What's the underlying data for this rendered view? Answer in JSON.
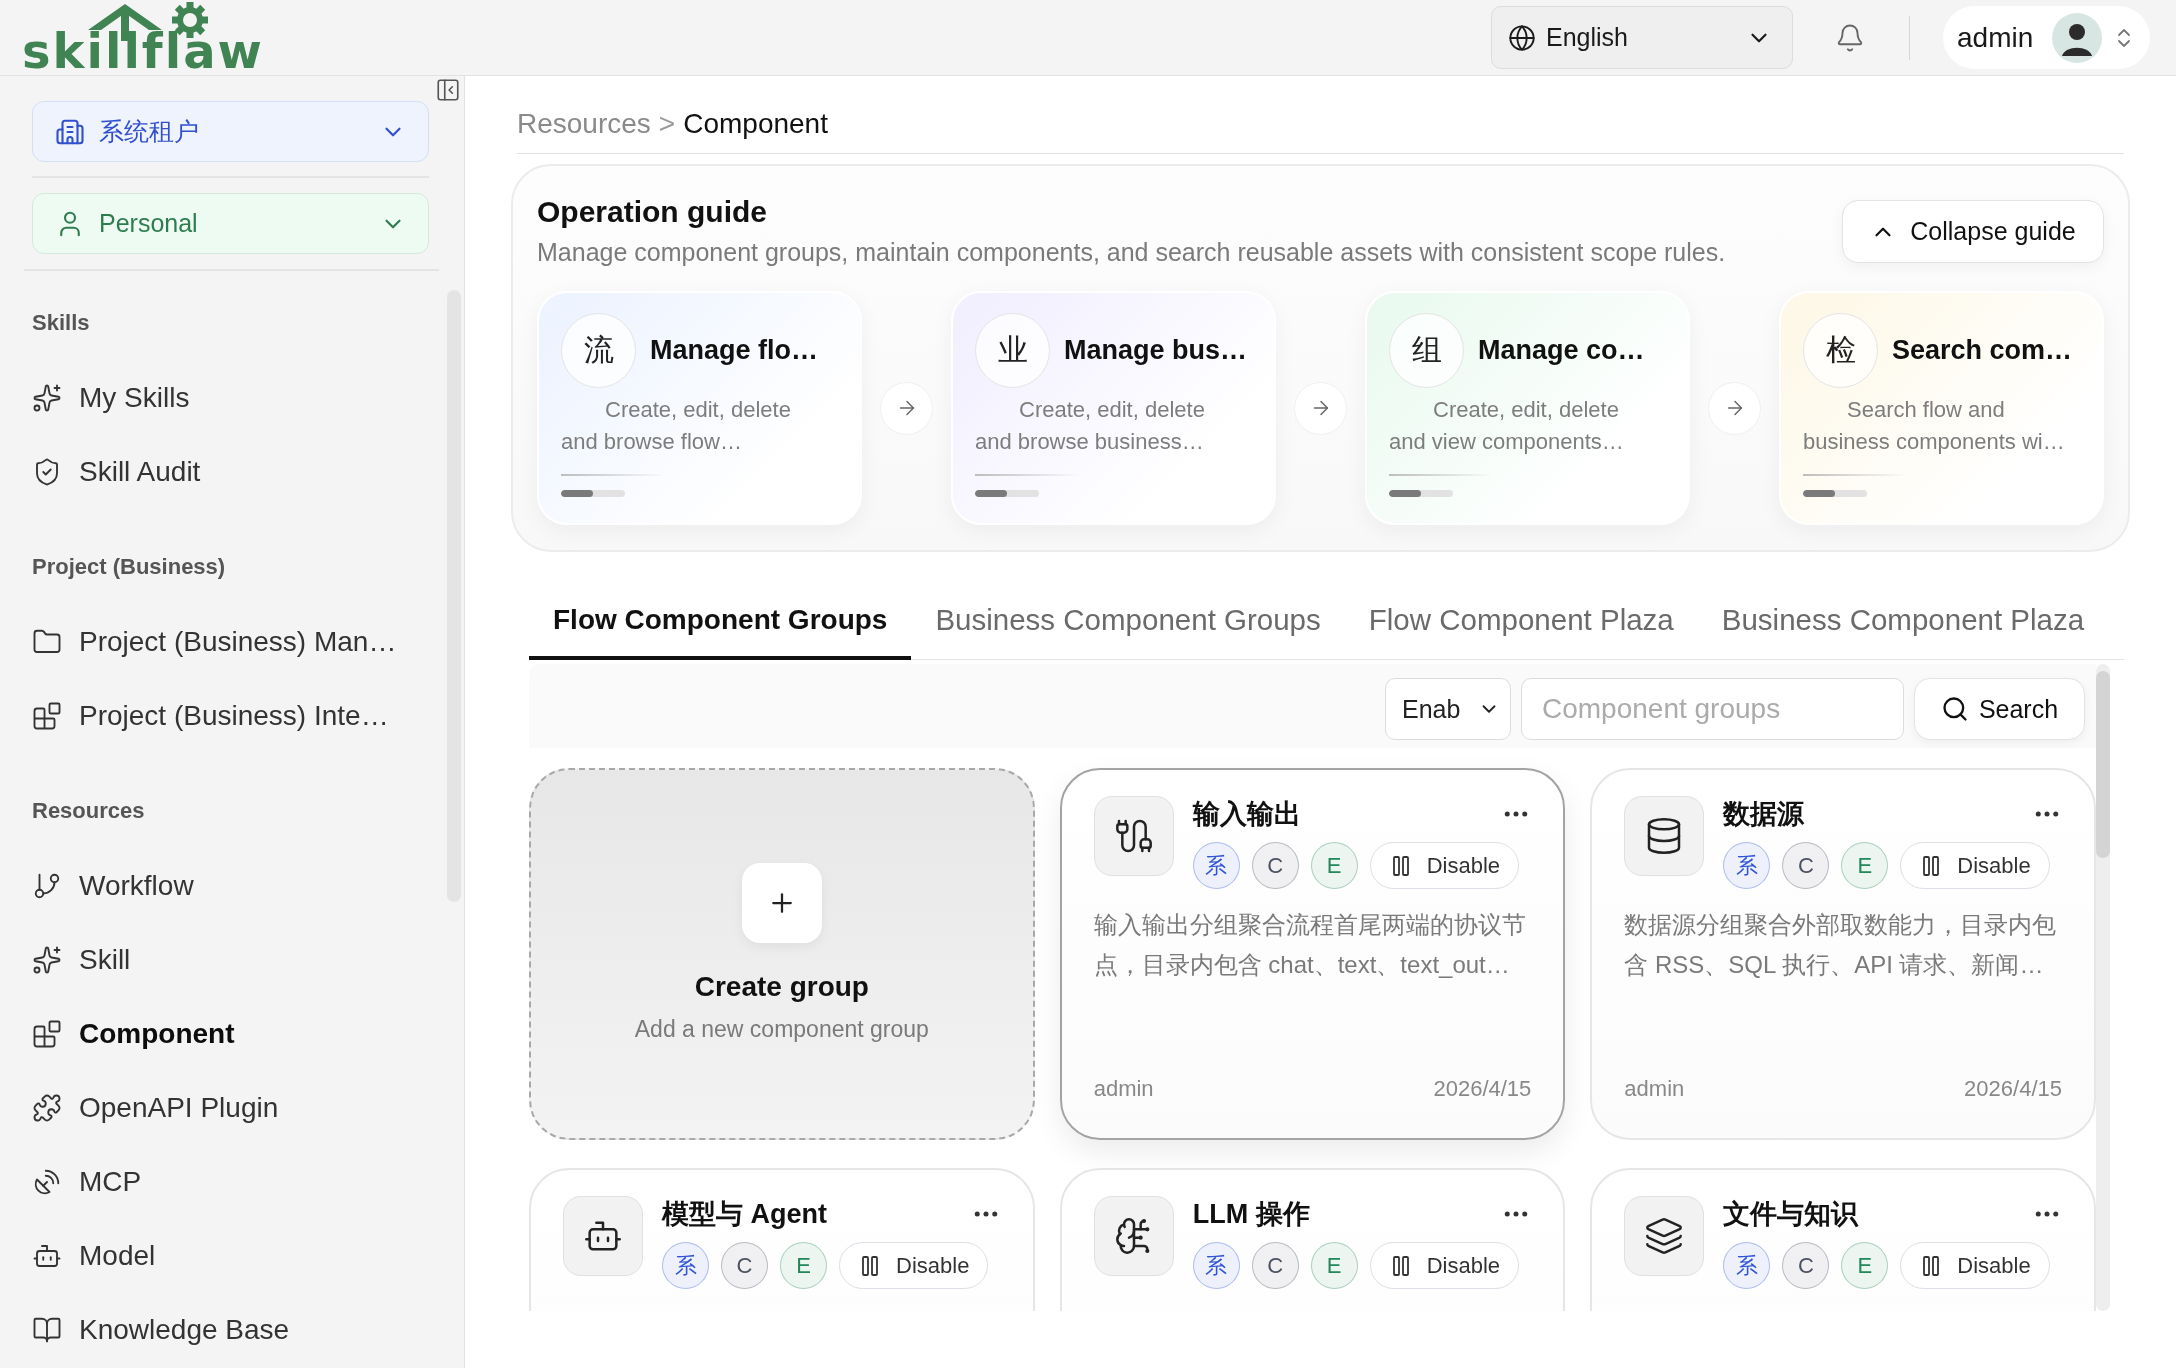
{
  "logo": {
    "text": "skillflaw"
  },
  "topbar": {
    "language": "English",
    "user": "admin"
  },
  "sidebar": {
    "tenant": "系统租户",
    "scope": "Personal",
    "sections": [
      {
        "title": "Skills",
        "items": [
          {
            "label": "My Skills",
            "selected": false
          },
          {
            "label": "Skill Audit",
            "selected": false
          }
        ]
      },
      {
        "title": "Project (Business)",
        "items": [
          {
            "label": "Project (Business) Man…",
            "selected": false
          },
          {
            "label": "Project (Business) Inte…",
            "selected": false
          }
        ]
      },
      {
        "title": "Resources",
        "items": [
          {
            "label": "Workflow",
            "selected": false
          },
          {
            "label": "Skill",
            "selected": false
          },
          {
            "label": "Component",
            "selected": true
          },
          {
            "label": "OpenAPI Plugin",
            "selected": false
          },
          {
            "label": "MCP",
            "selected": false
          },
          {
            "label": "Model",
            "selected": false
          },
          {
            "label": "Knowledge Base",
            "selected": false
          }
        ]
      }
    ]
  },
  "breadcrumb": {
    "items": [
      "Resources",
      "Component"
    ],
    "separator": ">"
  },
  "guide": {
    "title": "Operation guide",
    "description": "Manage component groups, maintain components, and search reusable assets with consistent scope rules.",
    "collapse_button": "Collapse guide",
    "steps": [
      {
        "glyph": "流",
        "title": "Manage flo…",
        "description": "Create, edit, delete and browse flow…",
        "color": "#edf3ff",
        "level": 0.5
      },
      {
        "glyph": "业",
        "title": "Manage bus…",
        "description": "Create, edit, delete and browse business…",
        "color": "#f2efff",
        "level": 0.5
      },
      {
        "glyph": "组",
        "title": "Manage co…",
        "description": "Create, edit, delete and view components…",
        "color": "#eafaf0",
        "level": 0.5
      },
      {
        "glyph": "检",
        "title": "Search com…",
        "description": "Search flow and business components wi…",
        "color": "#fdf8e7",
        "level": 0.5
      }
    ]
  },
  "tabs": [
    {
      "label": "Flow Component Groups",
      "selected": true
    },
    {
      "label": "Business Component Groups",
      "selected": false
    },
    {
      "label": "Flow Component Plaza",
      "selected": false
    },
    {
      "label": "Business Component Plaza",
      "selected": false
    }
  ],
  "filter": {
    "status": "Enab",
    "placeholder": "Component groups",
    "search_button": "Search"
  },
  "create_card": {
    "title": "Create group",
    "subtitle": "Add a new component group"
  },
  "groups": [
    {
      "name": "输入输出",
      "hovered": true,
      "badges": [
        {
          "label": "系",
          "color": "#2f54d4"
        },
        {
          "label": "C",
          "color": "#4b5262"
        },
        {
          "label": "E",
          "color": "#23875a"
        }
      ],
      "action": "Disable",
      "description": "输入输出分组聚合流程首尾两端的协议节点，目录内包含 chat、text、text_out…",
      "owner": "admin",
      "date": "2026/4/15"
    },
    {
      "name": "数据源",
      "hovered": false,
      "badges": [
        {
          "label": "系",
          "color": "#2f54d4"
        },
        {
          "label": "C",
          "color": "#4b5262"
        },
        {
          "label": "E",
          "color": "#23875a"
        }
      ],
      "action": "Disable",
      "description": "数据源分组聚合外部取数能力，目录内包含 RSS、SQL 执行、API 请求、新闻…",
      "owner": "admin",
      "date": "2026/4/15"
    },
    {
      "name": "模型与 Agent",
      "hovered": false,
      "badges": [
        {
          "label": "系",
          "color": "#2f54d4"
        },
        {
          "label": "C",
          "color": "#4b5262"
        },
        {
          "label": "E",
          "color": "#23875a"
        }
      ],
      "action": "Disable"
    },
    {
      "name": "LLM 操作",
      "hovered": false,
      "badges": [
        {
          "label": "系",
          "color": "#2f54d4"
        },
        {
          "label": "C",
          "color": "#4b5262"
        },
        {
          "label": "E",
          "color": "#23875a"
        }
      ],
      "action": "Disable"
    },
    {
      "name": "文件与知识",
      "hovered": false,
      "badges": [
        {
          "label": "系",
          "color": "#2f54d4"
        },
        {
          "label": "C",
          "color": "#4b5262"
        },
        {
          "label": "E",
          "color": "#23875a"
        }
      ],
      "action": "Disable"
    }
  ]
}
